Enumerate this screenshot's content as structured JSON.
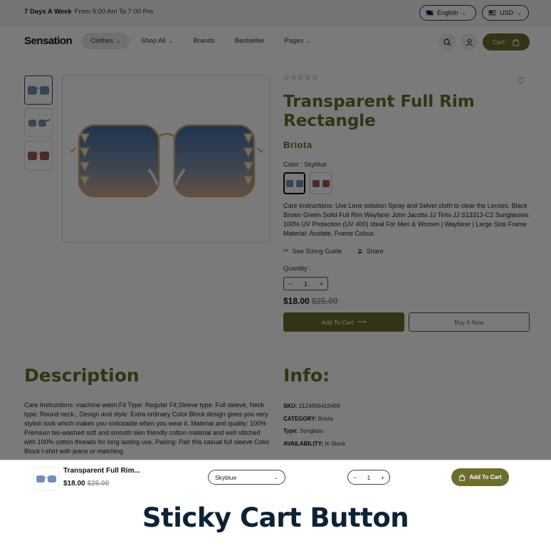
{
  "topbar": {
    "hours_bold": "7 Days A Week",
    "hours_text": "From 9:00 Am To 7:00 Pm",
    "language": "English",
    "currency": "USD"
  },
  "header": {
    "logo": "Sensation",
    "nav": [
      {
        "label": "Clothes",
        "has_dropdown": true
      },
      {
        "label": "Shop All",
        "has_dropdown": true
      },
      {
        "label": "Brands",
        "has_dropdown": false
      },
      {
        "label": "Bestseller",
        "has_dropdown": false
      },
      {
        "label": "Pages",
        "has_dropdown": true
      }
    ],
    "cart_label": "Cart:"
  },
  "product": {
    "title": "Transparent Full Rim Rectangle",
    "brand": "Briota",
    "color_label": "Color : Skyblue",
    "care": "Care Instructions: Use Lens solution Spray and Selvet cloth to clear the Lenses. Black Brown Green Solid Full Rim Wayfarer John Jacobs JJ Tints JJ S13313-C2 Sunglasses 100% UV Protection (UV 400) Ideal For Men & Women | Wayfarer | Large Size Frame Material: Acetate, Frame Colour.",
    "sizing_guide": "See Sizing Guide",
    "share": "Share",
    "quantity_label": "Quantity :",
    "quantity": "1",
    "price": "$18.00",
    "compare_price": "$25.00",
    "add_to_cart": "Add To Cart",
    "buy_now": "Buy It Now"
  },
  "description": {
    "heading": "Description",
    "text": "Care Instructions: machine wash;Fit Type: Regular Fit;Sleeve type: Full sleeve, Neck type: Round neck.; Design and style: Extra ordinary Color Block design gives you very stylish look which makes you noticeable when you wear it. Material and quality: 100% Premium bio-washed soft and smooth skin friendly cotton material and well stitched with 100% cotton threads for long lasting use. Pairing: Pair this casual full sleeve Color Block t-shirt with jeans or matching"
  },
  "info": {
    "heading": "Info:",
    "sku_label": "SKU:",
    "sku": "3124656415469",
    "category_label": "CATEGORY:",
    "category": "Briota",
    "type_label": "Type:",
    "type": "Sunglass",
    "availability_label": "AVAILABILITY:",
    "availability": "In Stock"
  },
  "sticky": {
    "name": "Transparent Full Rim...",
    "price": "$18.00",
    "compare_price": "$25.00",
    "variant": "Skyblue",
    "quantity": "1",
    "add_to_cart": "Add To Cart"
  },
  "caption": "Sticky Cart Button",
  "colors": {
    "accent": "#6c6e2d",
    "caption": "#0f2235"
  }
}
